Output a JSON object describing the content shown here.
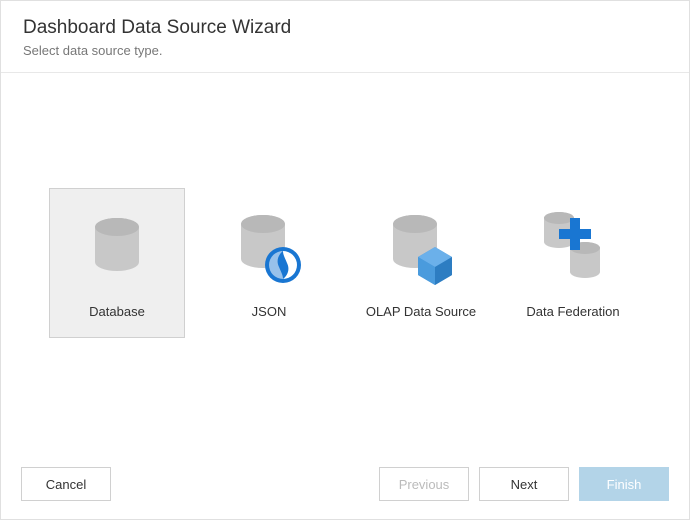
{
  "header": {
    "title": "Dashboard Data Source Wizard",
    "subtitle": "Select data source type."
  },
  "options": [
    {
      "label": "Database",
      "selected": true
    },
    {
      "label": "JSON",
      "selected": false
    },
    {
      "label": "OLAP Data Source",
      "selected": false
    },
    {
      "label": "Data Federation",
      "selected": false
    }
  ],
  "buttons": {
    "cancel": "Cancel",
    "previous": "Previous",
    "next": "Next",
    "finish": "Finish"
  }
}
